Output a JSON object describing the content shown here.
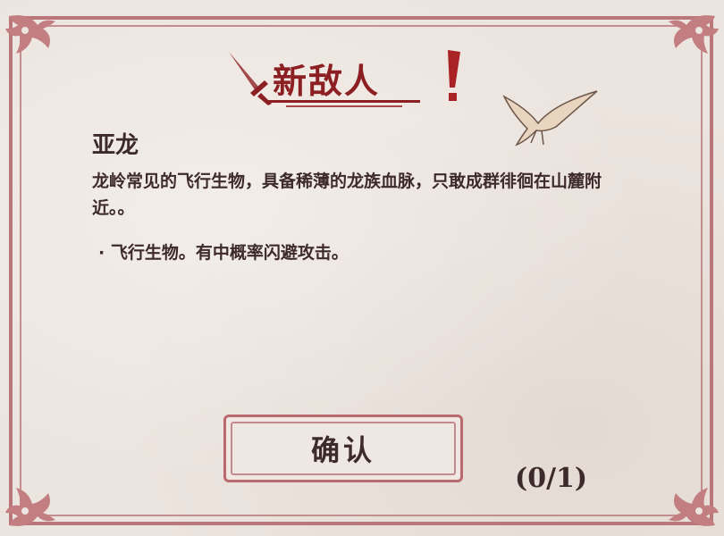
{
  "dialog": {
    "title": "新敌人",
    "enemy_name": "亚龙",
    "description": "龙岭常见的飞行生物，具备稀薄的龙族血脉，只敢成群徘徊在山麓附近。。",
    "traits": [
      "· 飞行生物。有中概率闪避攻击。"
    ],
    "confirm_label": "确认",
    "progress": "(0/1)"
  },
  "colors": {
    "frame": "#b9767b",
    "title": "#8c1f22",
    "text": "#3d2a2a",
    "background": "#ece4de"
  },
  "icons": [
    "sword-icon",
    "exclamation-icon",
    "pterosaur-icon",
    "corner-ornament-icon"
  ]
}
